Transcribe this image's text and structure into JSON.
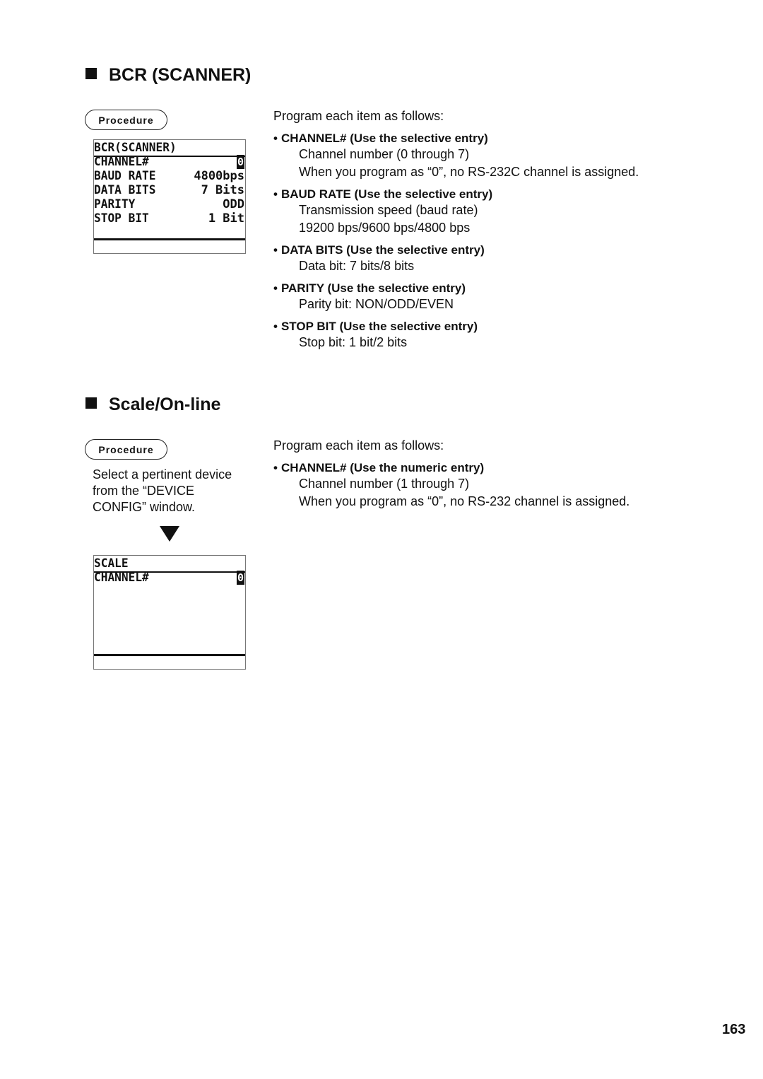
{
  "sections": [
    {
      "title": "BCR (SCANNER)",
      "procedure_label": "Procedure",
      "lcd": {
        "title": "BCR(SCANNER)",
        "rows": [
          {
            "label": "CHANNEL#",
            "value": "0",
            "cursor": true
          },
          {
            "label": "BAUD RATE",
            "value": "4800bps"
          },
          {
            "label": "DATA BITS",
            "value": "7 Bits"
          },
          {
            "label": "PARITY",
            "value": "ODD"
          },
          {
            "label": "STOP BIT",
            "value": "1 Bit"
          }
        ]
      },
      "intro": "Program each item as follows:",
      "items": [
        {
          "heading": "CHANNEL# (Use the selective entry)",
          "lines": [
            "Channel number (0 through 7)",
            "When you program as “0”, no RS-232C channel is assigned."
          ]
        },
        {
          "heading": "BAUD RATE (Use the selective entry)",
          "lines": [
            "Transmission speed (baud rate)",
            "19200 bps/9600 bps/4800 bps"
          ]
        },
        {
          "heading": "DATA BITS (Use the selective entry)",
          "lines": [
            "Data bit:  7 bits/8 bits"
          ]
        },
        {
          "heading": "PARITY (Use the selective entry)",
          "lines": [
            "Parity bit:  NON/ODD/EVEN"
          ]
        },
        {
          "heading": "STOP BIT (Use the selective entry)",
          "lines": [
            "Stop bit:  1 bit/2 bits"
          ]
        }
      ]
    },
    {
      "title": "Scale/On-line",
      "procedure_label": "Procedure",
      "procedure_text": [
        "Select a pertinent device",
        "from the “DEVICE",
        "CONFIG” window."
      ],
      "lcd": {
        "title": "SCALE",
        "rows": [
          {
            "label": "CHANNEL#",
            "value": "0",
            "cursor": true
          }
        ]
      },
      "intro": "Program each item as follows:",
      "items": [
        {
          "heading": "CHANNEL# (Use the numeric entry)",
          "lines": [
            "Channel number (1 through 7)",
            "When you program as “0”, no RS-232 channel is assigned."
          ]
        }
      ]
    }
  ],
  "bullet": "•",
  "page_number": "163"
}
